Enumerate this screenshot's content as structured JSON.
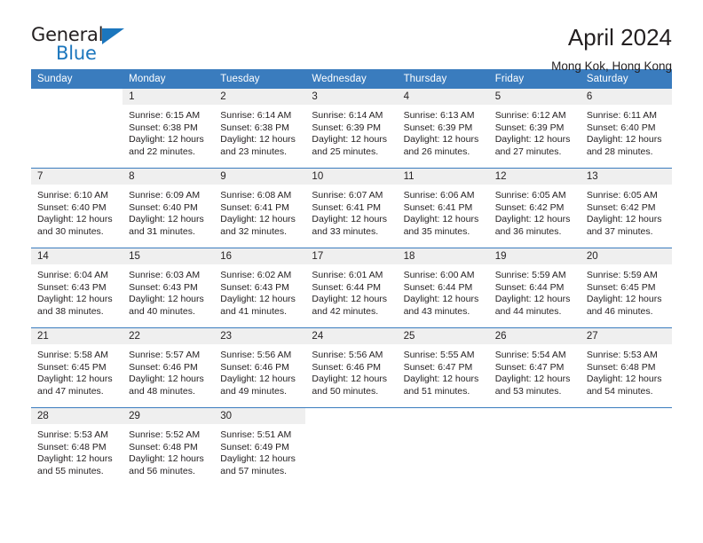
{
  "brand": {
    "name_part1": "General",
    "name_part2": "Blue",
    "accent_color": "#1b76bd"
  },
  "header": {
    "title": "April 2024",
    "location": "Mong Kok, Hong Kong"
  },
  "calendar": {
    "header_bg": "#3a7cbe",
    "daynum_bg": "#efefef",
    "weekday_headers": [
      "Sunday",
      "Monday",
      "Tuesday",
      "Wednesday",
      "Thursday",
      "Friday",
      "Saturday"
    ],
    "weeks": [
      [
        {
          "day": "",
          "sunrise": "",
          "sunset": "",
          "daylight1": "",
          "daylight2": "",
          "blank": true
        },
        {
          "day": "1",
          "sunrise": "Sunrise: 6:15 AM",
          "sunset": "Sunset: 6:38 PM",
          "daylight1": "Daylight: 12 hours",
          "daylight2": "and 22 minutes."
        },
        {
          "day": "2",
          "sunrise": "Sunrise: 6:14 AM",
          "sunset": "Sunset: 6:38 PM",
          "daylight1": "Daylight: 12 hours",
          "daylight2": "and 23 minutes."
        },
        {
          "day": "3",
          "sunrise": "Sunrise: 6:14 AM",
          "sunset": "Sunset: 6:39 PM",
          "daylight1": "Daylight: 12 hours",
          "daylight2": "and 25 minutes."
        },
        {
          "day": "4",
          "sunrise": "Sunrise: 6:13 AM",
          "sunset": "Sunset: 6:39 PM",
          "daylight1": "Daylight: 12 hours",
          "daylight2": "and 26 minutes."
        },
        {
          "day": "5",
          "sunrise": "Sunrise: 6:12 AM",
          "sunset": "Sunset: 6:39 PM",
          "daylight1": "Daylight: 12 hours",
          "daylight2": "and 27 minutes."
        },
        {
          "day": "6",
          "sunrise": "Sunrise: 6:11 AM",
          "sunset": "Sunset: 6:40 PM",
          "daylight1": "Daylight: 12 hours",
          "daylight2": "and 28 minutes."
        }
      ],
      [
        {
          "day": "7",
          "sunrise": "Sunrise: 6:10 AM",
          "sunset": "Sunset: 6:40 PM",
          "daylight1": "Daylight: 12 hours",
          "daylight2": "and 30 minutes."
        },
        {
          "day": "8",
          "sunrise": "Sunrise: 6:09 AM",
          "sunset": "Sunset: 6:40 PM",
          "daylight1": "Daylight: 12 hours",
          "daylight2": "and 31 minutes."
        },
        {
          "day": "9",
          "sunrise": "Sunrise: 6:08 AM",
          "sunset": "Sunset: 6:41 PM",
          "daylight1": "Daylight: 12 hours",
          "daylight2": "and 32 minutes."
        },
        {
          "day": "10",
          "sunrise": "Sunrise: 6:07 AM",
          "sunset": "Sunset: 6:41 PM",
          "daylight1": "Daylight: 12 hours",
          "daylight2": "and 33 minutes."
        },
        {
          "day": "11",
          "sunrise": "Sunrise: 6:06 AM",
          "sunset": "Sunset: 6:41 PM",
          "daylight1": "Daylight: 12 hours",
          "daylight2": "and 35 minutes."
        },
        {
          "day": "12",
          "sunrise": "Sunrise: 6:05 AM",
          "sunset": "Sunset: 6:42 PM",
          "daylight1": "Daylight: 12 hours",
          "daylight2": "and 36 minutes."
        },
        {
          "day": "13",
          "sunrise": "Sunrise: 6:05 AM",
          "sunset": "Sunset: 6:42 PM",
          "daylight1": "Daylight: 12 hours",
          "daylight2": "and 37 minutes."
        }
      ],
      [
        {
          "day": "14",
          "sunrise": "Sunrise: 6:04 AM",
          "sunset": "Sunset: 6:43 PM",
          "daylight1": "Daylight: 12 hours",
          "daylight2": "and 38 minutes."
        },
        {
          "day": "15",
          "sunrise": "Sunrise: 6:03 AM",
          "sunset": "Sunset: 6:43 PM",
          "daylight1": "Daylight: 12 hours",
          "daylight2": "and 40 minutes."
        },
        {
          "day": "16",
          "sunrise": "Sunrise: 6:02 AM",
          "sunset": "Sunset: 6:43 PM",
          "daylight1": "Daylight: 12 hours",
          "daylight2": "and 41 minutes."
        },
        {
          "day": "17",
          "sunrise": "Sunrise: 6:01 AM",
          "sunset": "Sunset: 6:44 PM",
          "daylight1": "Daylight: 12 hours",
          "daylight2": "and 42 minutes."
        },
        {
          "day": "18",
          "sunrise": "Sunrise: 6:00 AM",
          "sunset": "Sunset: 6:44 PM",
          "daylight1": "Daylight: 12 hours",
          "daylight2": "and 43 minutes."
        },
        {
          "day": "19",
          "sunrise": "Sunrise: 5:59 AM",
          "sunset": "Sunset: 6:44 PM",
          "daylight1": "Daylight: 12 hours",
          "daylight2": "and 44 minutes."
        },
        {
          "day": "20",
          "sunrise": "Sunrise: 5:59 AM",
          "sunset": "Sunset: 6:45 PM",
          "daylight1": "Daylight: 12 hours",
          "daylight2": "and 46 minutes."
        }
      ],
      [
        {
          "day": "21",
          "sunrise": "Sunrise: 5:58 AM",
          "sunset": "Sunset: 6:45 PM",
          "daylight1": "Daylight: 12 hours",
          "daylight2": "and 47 minutes."
        },
        {
          "day": "22",
          "sunrise": "Sunrise: 5:57 AM",
          "sunset": "Sunset: 6:46 PM",
          "daylight1": "Daylight: 12 hours",
          "daylight2": "and 48 minutes."
        },
        {
          "day": "23",
          "sunrise": "Sunrise: 5:56 AM",
          "sunset": "Sunset: 6:46 PM",
          "daylight1": "Daylight: 12 hours",
          "daylight2": "and 49 minutes."
        },
        {
          "day": "24",
          "sunrise": "Sunrise: 5:56 AM",
          "sunset": "Sunset: 6:46 PM",
          "daylight1": "Daylight: 12 hours",
          "daylight2": "and 50 minutes."
        },
        {
          "day": "25",
          "sunrise": "Sunrise: 5:55 AM",
          "sunset": "Sunset: 6:47 PM",
          "daylight1": "Daylight: 12 hours",
          "daylight2": "and 51 minutes."
        },
        {
          "day": "26",
          "sunrise": "Sunrise: 5:54 AM",
          "sunset": "Sunset: 6:47 PM",
          "daylight1": "Daylight: 12 hours",
          "daylight2": "and 53 minutes."
        },
        {
          "day": "27",
          "sunrise": "Sunrise: 5:53 AM",
          "sunset": "Sunset: 6:48 PM",
          "daylight1": "Daylight: 12 hours",
          "daylight2": "and 54 minutes."
        }
      ],
      [
        {
          "day": "28",
          "sunrise": "Sunrise: 5:53 AM",
          "sunset": "Sunset: 6:48 PM",
          "daylight1": "Daylight: 12 hours",
          "daylight2": "and 55 minutes."
        },
        {
          "day": "29",
          "sunrise": "Sunrise: 5:52 AM",
          "sunset": "Sunset: 6:48 PM",
          "daylight1": "Daylight: 12 hours",
          "daylight2": "and 56 minutes."
        },
        {
          "day": "30",
          "sunrise": "Sunrise: 5:51 AM",
          "sunset": "Sunset: 6:49 PM",
          "daylight1": "Daylight: 12 hours",
          "daylight2": "and 57 minutes."
        },
        {
          "day": "",
          "sunrise": "",
          "sunset": "",
          "daylight1": "",
          "daylight2": "",
          "blank": true
        },
        {
          "day": "",
          "sunrise": "",
          "sunset": "",
          "daylight1": "",
          "daylight2": "",
          "blank": true
        },
        {
          "day": "",
          "sunrise": "",
          "sunset": "",
          "daylight1": "",
          "daylight2": "",
          "blank": true
        },
        {
          "day": "",
          "sunrise": "",
          "sunset": "",
          "daylight1": "",
          "daylight2": "",
          "blank": true
        }
      ]
    ]
  }
}
